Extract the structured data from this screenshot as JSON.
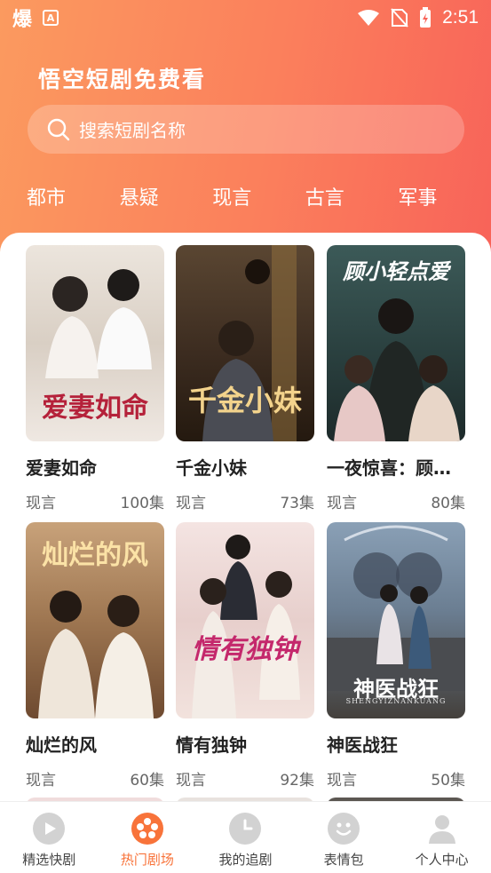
{
  "status_bar": {
    "time": "2:51",
    "app_glyph": "爆",
    "badge_letter": "A"
  },
  "header": {
    "title": "悟空短剧免费看"
  },
  "search": {
    "placeholder": "搜索短剧名称"
  },
  "categories": [
    "都市",
    "悬疑",
    "现言",
    "古言",
    "军事"
  ],
  "dramas": [
    {
      "poster_text": "爱妻如命",
      "name": "爱妻如命",
      "genre": "现言",
      "episodes": "100集"
    },
    {
      "poster_text": "千金小妹",
      "name": "千金小妹",
      "genre": "现言",
      "episodes": "73集"
    },
    {
      "poster_text": "顾小轻点爱",
      "name": "一夜惊喜：顾…",
      "genre": "现言",
      "episodes": "80集"
    },
    {
      "poster_text": "灿烂的风",
      "name": "灿烂的风",
      "genre": "现言",
      "episodes": "60集"
    },
    {
      "poster_text": "情有独钟",
      "name": "情有独钟",
      "genre": "现言",
      "episodes": "92集"
    },
    {
      "poster_text": "神医战狂",
      "poster_subtext": "SHENGYIZNANKUANG",
      "name": "神医战狂",
      "genre": "现言",
      "episodes": "50集"
    }
  ],
  "tabs": [
    {
      "label": "精选快剧",
      "icon": "play-icon"
    },
    {
      "label": "热门剧场",
      "icon": "film-reel-icon",
      "active": true
    },
    {
      "label": "我的追剧",
      "icon": "clock-icon"
    },
    {
      "label": "表情包",
      "icon": "smiley-icon"
    },
    {
      "label": "个人中心",
      "icon": "person-icon"
    }
  ],
  "colors": {
    "accent": "#f8733a",
    "header_start": "#fb9a5f",
    "header_end": "#f86359"
  }
}
